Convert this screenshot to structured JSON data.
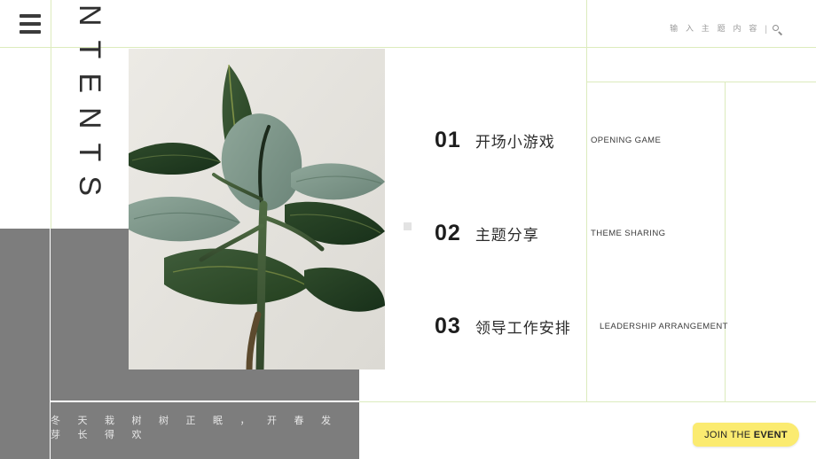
{
  "header": {
    "menu_icon": "hamburger-icon",
    "search": {
      "placeholder": "输 入 主 题 内 容",
      "divider": "|",
      "icon": "search-icon"
    }
  },
  "contents": {
    "vertical_title": "CONTENTS"
  },
  "photo": {
    "alt": "rubber-plant-photo"
  },
  "agenda": {
    "items": [
      {
        "number": "01",
        "title_cn": "开场小游戏",
        "title_en": "OPENING GAME"
      },
      {
        "number": "02",
        "title_cn": "主题分享",
        "title_en": "THEME SHARING"
      },
      {
        "number": "03",
        "title_cn": "领导工作安排",
        "title_en": "LEADERSHIP ARRANGEMENT"
      }
    ]
  },
  "caption": {
    "text": "冬 天 栽 树 树 正 眠 ， 开 春 发 芽 长 得 欢"
  },
  "cta": {
    "label_light": "JOIN THE ",
    "label_bold": "EVENT"
  },
  "colors": {
    "grid_line": "#dcebbd",
    "gray_block": "#7d7d7d",
    "cta_yellow": "#fbeb70",
    "ink": "#1d1d1d",
    "muted": "#9a9a9a"
  }
}
